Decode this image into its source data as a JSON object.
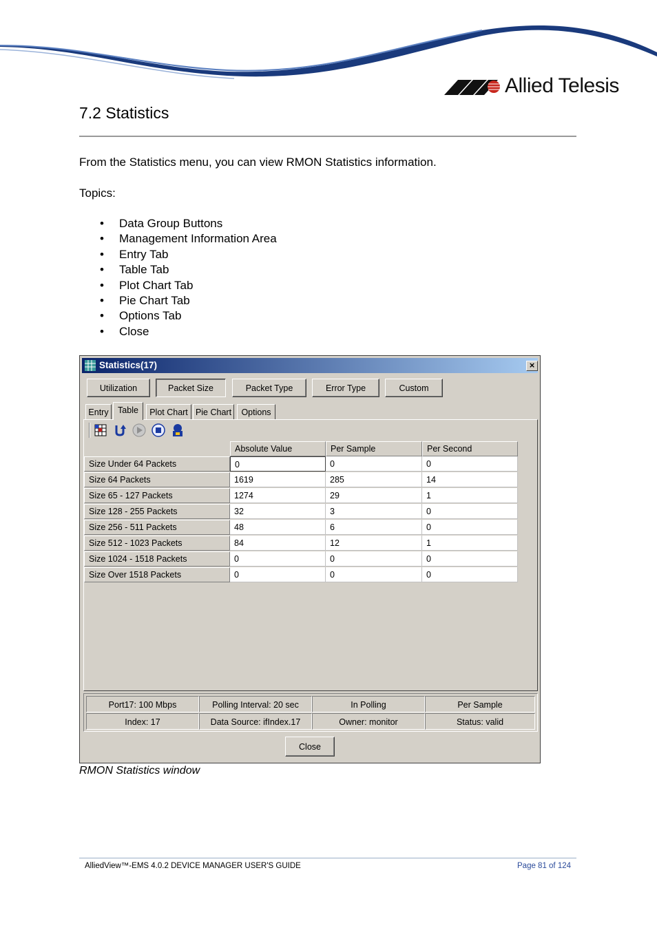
{
  "brand": {
    "name": "Allied Telesis"
  },
  "section": {
    "title": "7.2 Statistics"
  },
  "intro": "From the Statistics menu, you can view RMON Statistics information.",
  "topics_label": "Topics:",
  "topics": [
    "Data Group Buttons",
    "Management Information Area",
    "Entry Tab",
    "Table Tab",
    "Plot Chart Tab",
    "Pie Chart Tab",
    "Options Tab",
    "Close"
  ],
  "window": {
    "title": "Statistics(17)",
    "close_glyph": "×",
    "group_buttons": [
      "Utilization",
      "Packet Size",
      "Packet Type",
      "Error Type",
      "Custom"
    ],
    "tabs": [
      "Entry",
      "Table",
      "Plot Chart",
      "Pie Chart",
      "Options"
    ],
    "toolbar_icons": [
      "grid-export-icon",
      "refresh-icon",
      "play-icon",
      "stop-icon",
      "lock-user-icon"
    ],
    "columns": [
      "Absolute Value",
      "Per Sample",
      "Per Second"
    ],
    "rows": [
      {
        "label": "Size Under 64 Packets",
        "values": [
          "0",
          "0",
          "0"
        ]
      },
      {
        "label": "Size 64 Packets",
        "values": [
          "1619",
          "285",
          "14"
        ]
      },
      {
        "label": "Size 65 - 127 Packets",
        "values": [
          "1274",
          "29",
          "1"
        ]
      },
      {
        "label": "Size 128 - 255 Packets",
        "values": [
          "32",
          "3",
          "0"
        ]
      },
      {
        "label": "Size 256 - 511 Packets",
        "values": [
          "48",
          "6",
          "0"
        ]
      },
      {
        "label": "Size 512 - 1023 Packets",
        "values": [
          "84",
          "12",
          "1"
        ]
      },
      {
        "label": "Size 1024 - 1518 Packets",
        "values": [
          "0",
          "0",
          "0"
        ]
      },
      {
        "label": "Size Over 1518 Packets",
        "values": [
          "0",
          "0",
          "0"
        ]
      }
    ],
    "status": [
      [
        "Port17: 100 Mbps",
        "Polling Interval: 20 sec",
        "In Polling",
        "Per Sample"
      ],
      [
        "Index: 17",
        "Data Source: ifIndex.17",
        "Owner: monitor",
        "Status: valid"
      ]
    ],
    "close_label": "Close"
  },
  "caption": "RMON Statistics window",
  "footer": {
    "left": "AlliedView™-EMS 4.0.2  DEVICE MANAGER USER'S GUIDE",
    "right": "Page 81 of 124"
  }
}
